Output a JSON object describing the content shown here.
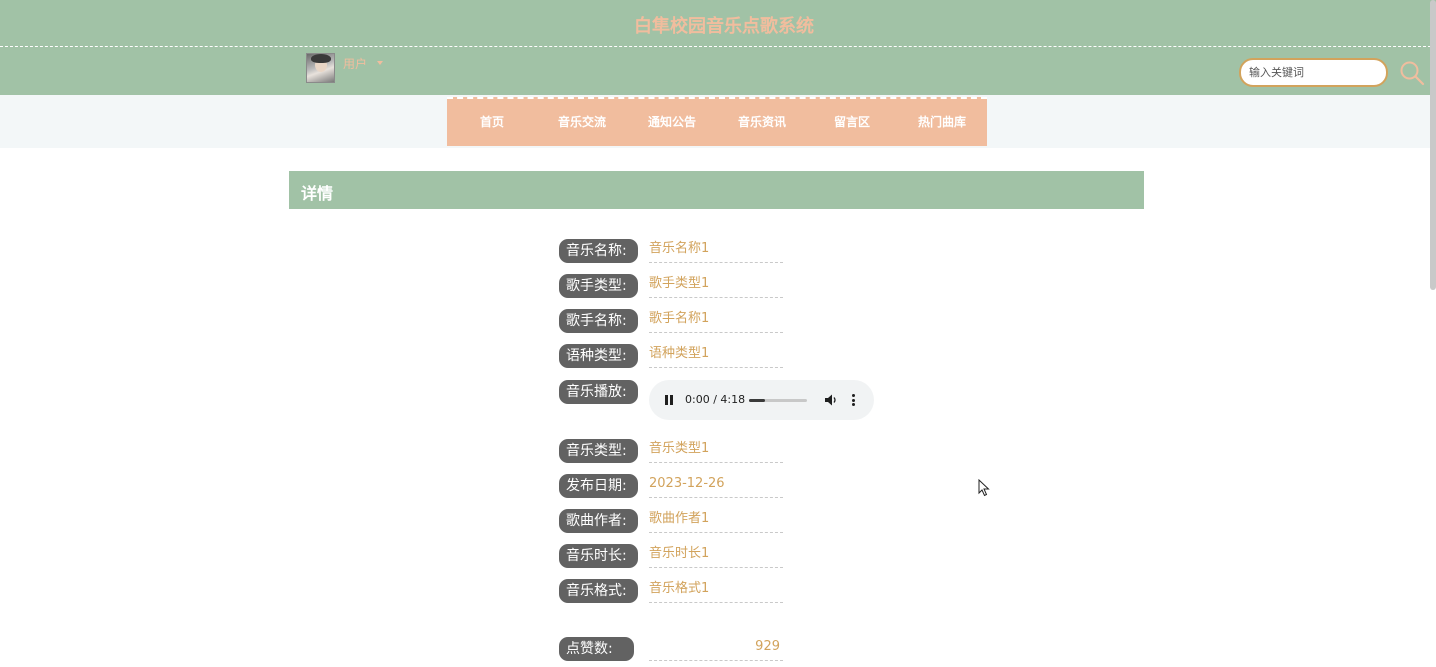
{
  "header": {
    "site_title": "白隼校园音乐点歌系统",
    "user_name": "用户",
    "search_placeholder": "输入关键词"
  },
  "nav": {
    "items": [
      "首页",
      "音乐交流",
      "通知公告",
      "音乐资讯",
      "留言区",
      "热门曲库"
    ]
  },
  "detail": {
    "title": "详情",
    "fields": [
      {
        "label": "音乐名称:",
        "value": "音乐名称1"
      },
      {
        "label": "歌手类型:",
        "value": "歌手类型1"
      },
      {
        "label": "歌手名称:",
        "value": "歌手名称1"
      },
      {
        "label": "语种类型:",
        "value": "语种类型1"
      },
      {
        "label": "音乐播放:",
        "value": ""
      },
      {
        "label": "音乐类型:",
        "value": "音乐类型1"
      },
      {
        "label": "发布日期:",
        "value": "2023-12-26"
      },
      {
        "label": "歌曲作者:",
        "value": "歌曲作者1"
      },
      {
        "label": "音乐时长:",
        "value": "音乐时长1"
      },
      {
        "label": "音乐格式:",
        "value": "音乐格式1"
      },
      {
        "label": "点赞数:",
        "value": "929"
      }
    ],
    "audio": {
      "time": "0:00 / 4:18",
      "progress": 0.28,
      "state": "playing"
    }
  },
  "colors": {
    "header_bg": "#a1c2a6",
    "accent_peach": "#f1bd9e",
    "value_gold": "#d2a35c",
    "label_bg": "#626262"
  },
  "icons": {
    "search": "search-icon",
    "caret": "chevron-down-icon",
    "pause": "pause-icon",
    "volume": "volume-icon",
    "more": "more-vertical-icon"
  }
}
